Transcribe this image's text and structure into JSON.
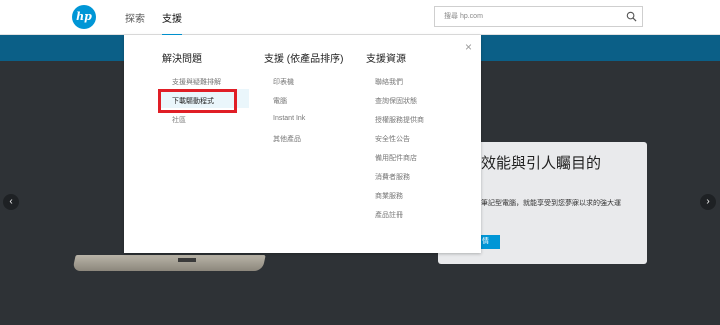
{
  "header": {
    "logo_text": "hp",
    "nav": {
      "explore": "探索",
      "support": "支援"
    },
    "search": {
      "placeholder": "搜尋 hp.com"
    }
  },
  "hero": {
    "title": "大的效能與引人矚目的",
    "subtitle": "筆記型電腦，就能享受到您夢寐以求的強大運",
    "button_label": "情",
    "prev": "‹",
    "next": "›"
  },
  "menu": {
    "close": "×",
    "columns": [
      {
        "heading": "解決問題",
        "links": [
          "支援與疑難排解",
          "下載驅動程式",
          "社區"
        ]
      },
      {
        "heading": "支援 (依產品排序)",
        "links": [
          "印表機",
          "電腦",
          "Instant Ink",
          "其他產品"
        ]
      },
      {
        "heading": "支援資源",
        "links": [
          "聯絡我們",
          "查詢保固狀態",
          "授權服務提供商",
          "安全性公告",
          "備用配件商店",
          "消費者服務",
          "商業服務",
          "產品註冊"
        ]
      }
    ]
  },
  "colors": {
    "brand": "#0096d6",
    "band": "#0b5f87",
    "highlight": "#e01e26"
  }
}
